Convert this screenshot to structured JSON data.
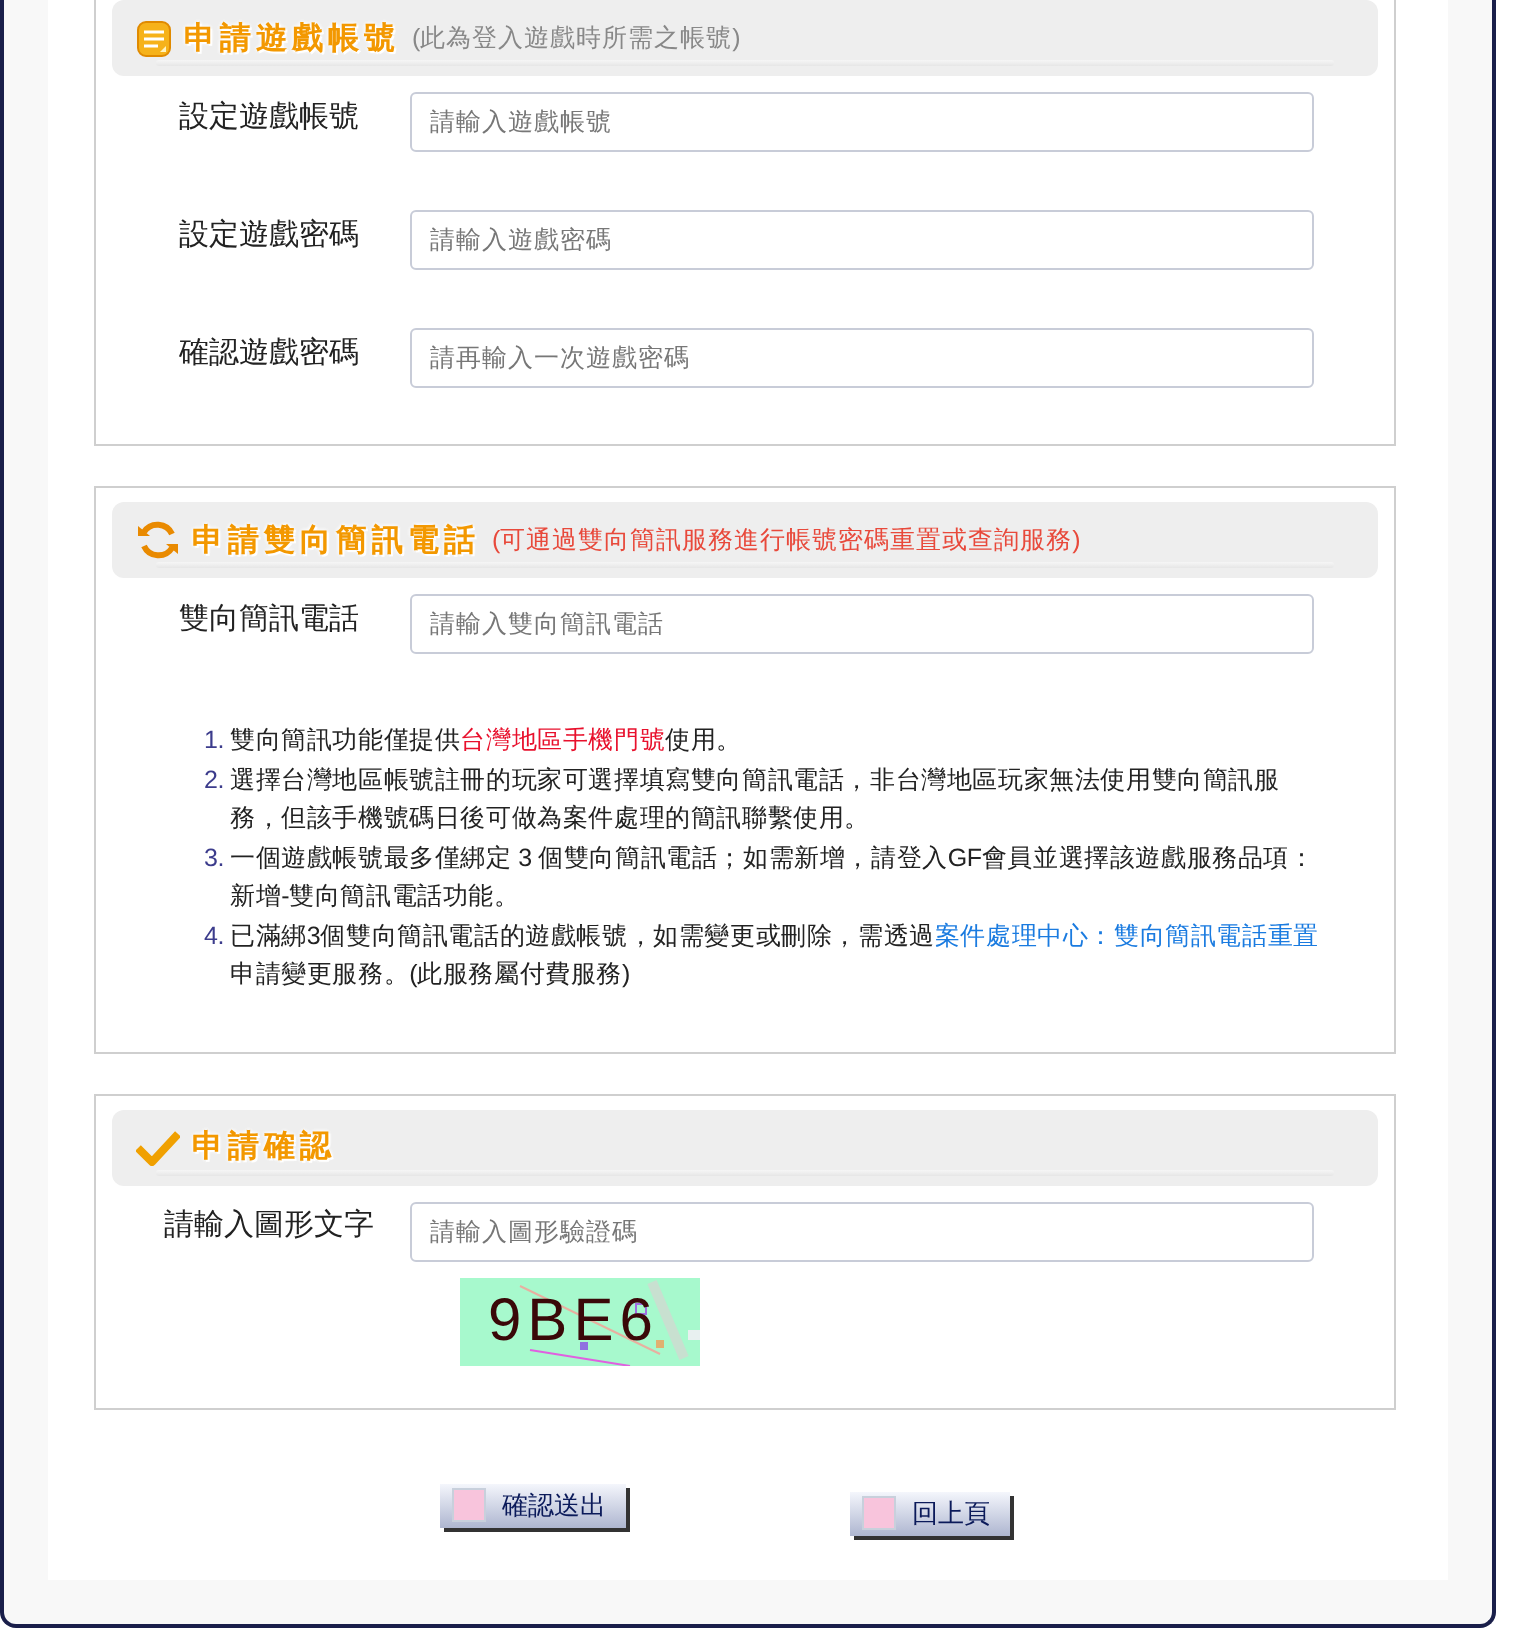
{
  "sections": [
    {
      "kind": "account",
      "title": "申請遊戲帳號",
      "subtitle": "(此為登入遊戲時所需之帳號)",
      "subtitle_alert": false,
      "fields": [
        {
          "label": "設定遊戲帳號",
          "placeholder": "請輸入遊戲帳號"
        },
        {
          "label": "設定遊戲密碼",
          "placeholder": "請輸入遊戲密碼"
        },
        {
          "label": "確認遊戲密碼",
          "placeholder": "請再輸入一次遊戲密碼"
        }
      ]
    },
    {
      "kind": "sms",
      "title": "申請雙向簡訊電話",
      "subtitle": "(可通過雙向簡訊服務進行帳號密碼重置或查詢服務)",
      "subtitle_alert": true,
      "fields": [
        {
          "label": "雙向簡訊電話",
          "placeholder": "請輸入雙向簡訊電話"
        }
      ],
      "notes": [
        {
          "number": "1.",
          "parts": [
            {
              "kind": "plain",
              "text": "雙向簡訊功能僅提供"
            },
            {
              "kind": "highlight",
              "text": "台灣地區手機門號"
            },
            {
              "kind": "plain",
              "text": "使用。"
            }
          ]
        },
        {
          "number": "2.",
          "parts": [
            {
              "kind": "plain",
              "text": "選擇台灣地區帳號註冊的玩家可選擇填寫雙向簡訊電話，非台灣地區玩家無法使用雙向簡訊服務，但該手機號碼日後可做為案件處理的簡訊聯繫使用。"
            }
          ]
        },
        {
          "number": "3.",
          "parts": [
            {
              "kind": "plain",
              "text": "一個遊戲帳號最多僅綁定 3 個雙向簡訊電話；如需新增，請登入GF會員並選擇該遊戲服務品項：新增-雙向簡訊電話功能。"
            }
          ]
        },
        {
          "number": "4.",
          "parts": [
            {
              "kind": "plain",
              "text": "已滿綁3個雙向簡訊電話的遊戲帳號，如需變更或刪除，需透過"
            },
            {
              "kind": "link",
              "text": "案件處理中心：雙向簡訊電話重置"
            },
            {
              "kind": "plain",
              "text": "申請變更服務。(此服務屬付費服務)"
            }
          ]
        }
      ]
    },
    {
      "kind": "confirm",
      "title": "申請確認",
      "fields": [
        {
          "label": "請輸入圖形文字",
          "placeholder": "請輸入圖形驗證碼"
        }
      ],
      "captcha": "9BE6"
    }
  ],
  "buttons": [
    {
      "label": "確認送出"
    },
    {
      "label": "回上頁"
    }
  ]
}
